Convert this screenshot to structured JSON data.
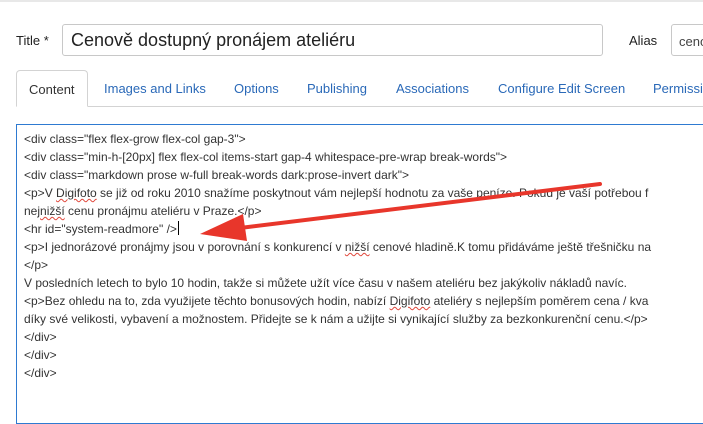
{
  "title_field": {
    "label": "Title *",
    "value": "Cenově dostupný pronájem ateliéru"
  },
  "alias_field": {
    "label": "Alias",
    "value": "cenove-dostupny-pronajem-ateliéru"
  },
  "tabs": [
    {
      "label": "Content",
      "active": true
    },
    {
      "label": "Images and Links",
      "active": false
    },
    {
      "label": "Options",
      "active": false
    },
    {
      "label": "Publishing",
      "active": false
    },
    {
      "label": "Associations",
      "active": false
    },
    {
      "label": "Configure Edit Screen",
      "active": false
    },
    {
      "label": "Permissions",
      "active": false
    }
  ],
  "editor": {
    "lines": [
      "<div class=\"flex flex-grow flex-col gap-3\">",
      "<div class=\"min-h-[20px] flex flex-col items-start gap-4 whitespace-pre-wrap break-words\">",
      "<div class=\"markdown prose w-full break-words dark:prose-invert dark\">",
      "<p>V Digifoto se již od roku 2010 snažíme poskytnout vám nejlepší hodnotu za vaše peníze. Pokud je vaší potřebou f",
      "nejnižší cenu pronájmu ateliéru v Praze.</p>",
      "<hr id=\"system-readmore\" />",
      "<p>I jednorázové pronájmy jsou v porovnání s konkurencí v nižší cenové hladině.K tomu přidáváme ještě třešničku na",
      "</p>",
      "V posledních letech to bylo 10 hodin, takže si můžete užít více času v našem ateliéru bez jakýkoliv nákladů navíc.",
      "<p>Bez ohledu na to, zda využijete těchto bonusových hodin, nabízí Digifoto ateliéry s nejlepším poměrem cena / kva",
      "díky své velikosti, vybavení a možnostem. Přidejte se k nám a užijte si vynikající služby za bezkonkurenční cenu.</p>",
      "</div>",
      "</div>",
      "</div>"
    ],
    "misspelled_words": [
      "Digifoto",
      "nižší"
    ]
  },
  "annotation": {
    "color": "#e8362b",
    "shape": "red-arrow"
  }
}
